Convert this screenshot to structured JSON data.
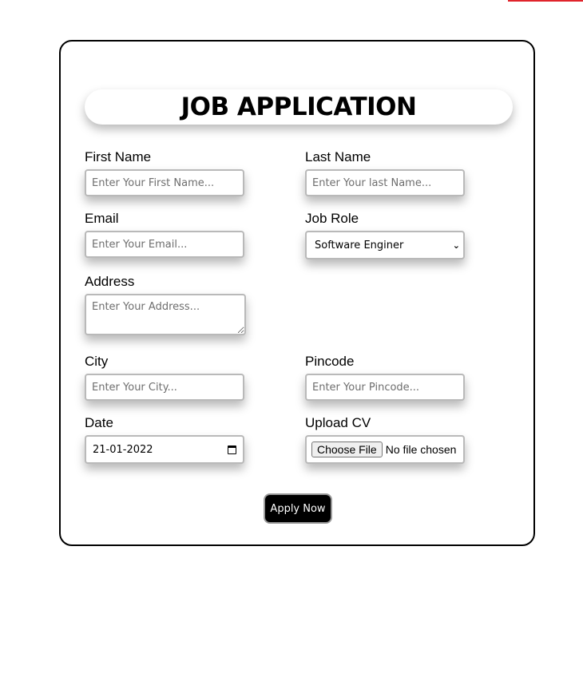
{
  "form": {
    "title": "JOB APPLICATION",
    "fields": {
      "first_name": {
        "label": "First Name",
        "placeholder": "Enter Your First Name..."
      },
      "last_name": {
        "label": "Last Name",
        "placeholder": "Enter Your last Name..."
      },
      "email": {
        "label": "Email",
        "placeholder": "Enter Your Email..."
      },
      "job_role": {
        "label": "Job Role",
        "selected": "Software Enginer"
      },
      "address": {
        "label": "Address",
        "placeholder": "Enter Your Address..."
      },
      "city": {
        "label": "City",
        "placeholder": "Enter Your City..."
      },
      "pincode": {
        "label": "Pincode",
        "placeholder": "Enter Your Pincode..."
      },
      "date": {
        "label": "Date",
        "value": "21-01-2022"
      },
      "cv": {
        "label": "Upload CV",
        "button": "Choose File",
        "status": "No file chosen"
      }
    },
    "submit_label": "Apply Now"
  },
  "colors": {
    "accent": "#e0242b",
    "button_bg": "#000000",
    "border": "#000000"
  },
  "icons": {
    "select": "chevron-down-icon",
    "date": "calendar-icon"
  }
}
